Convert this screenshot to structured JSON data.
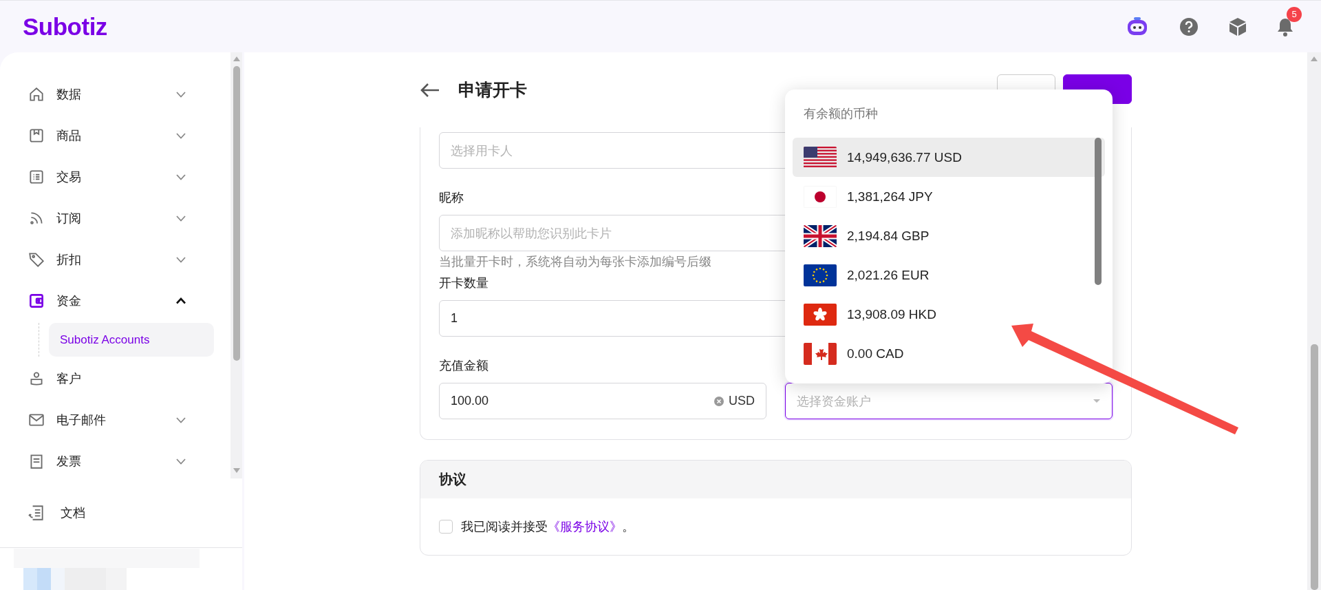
{
  "header": {
    "logo": "Subotiz",
    "notification_count": "5"
  },
  "sidebar": {
    "items": [
      {
        "label": "数据",
        "expandable": true,
        "expanded": false,
        "selected": false
      },
      {
        "label": "商品",
        "expandable": true,
        "expanded": false,
        "selected": false
      },
      {
        "label": "交易",
        "expandable": true,
        "expanded": false,
        "selected": false
      },
      {
        "label": "订阅",
        "expandable": true,
        "expanded": false,
        "selected": false
      },
      {
        "label": "折扣",
        "expandable": true,
        "expanded": false,
        "selected": false
      },
      {
        "label": "资金",
        "expandable": true,
        "expanded": true,
        "selected": true,
        "children": [
          {
            "label": "Subotiz Accounts",
            "selected": true
          }
        ]
      },
      {
        "label": "客户",
        "expandable": false,
        "selected": false
      },
      {
        "label": "电子邮件",
        "expandable": true,
        "expanded": false,
        "selected": false
      },
      {
        "label": "发票",
        "expandable": true,
        "expanded": false,
        "selected": false
      }
    ],
    "footer_item": {
      "label": "文档"
    }
  },
  "page": {
    "title": "申请开卡",
    "buttons": [
      {
        "kind": "secondary"
      },
      {
        "kind": "primary"
      }
    ]
  },
  "form": {
    "fields": [
      {
        "kind": "full",
        "placeholder": "选择用卡人"
      },
      {
        "kind": "full",
        "label": "昵称",
        "placeholder": "添加昵称以帮助您识别此卡片",
        "help": "当批量开卡时，系统将自动为每张卡添加编号后缀"
      },
      {
        "kind": "full",
        "label": "开卡数量",
        "value": "1"
      },
      {
        "kind": "amount",
        "label": "充值金额",
        "value": "100.00",
        "suffix": "USD"
      }
    ],
    "funding_select": {
      "placeholder": "选择资金账户",
      "focused": true
    }
  },
  "dropdown": {
    "heading": "有余额的币种",
    "options": [
      {
        "kind": "us",
        "amount": "14,949,636.77 USD",
        "selected": true
      },
      {
        "kind": "jp",
        "amount": "1,381,264 JPY",
        "selected": false
      },
      {
        "kind": "gb",
        "amount": "2,194.84 GBP",
        "selected": false
      },
      {
        "kind": "eu",
        "amount": "2,021.26 EUR",
        "selected": false
      },
      {
        "kind": "hk",
        "amount": "13,908.09 HKD",
        "selected": false
      },
      {
        "kind": "ca",
        "amount": "0.00 CAD",
        "selected": false
      }
    ]
  },
  "agreement": {
    "title": "协议",
    "checked": false,
    "text": "我已阅读并接受",
    "link": "《服务协议》",
    "suffix": "。"
  }
}
